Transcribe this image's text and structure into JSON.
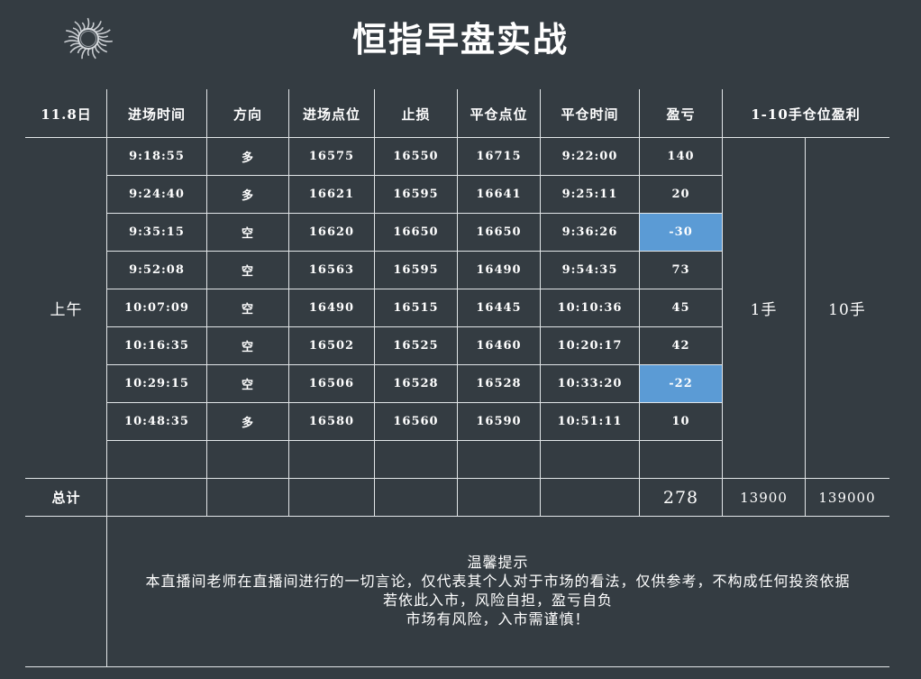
{
  "title": "恒指早盘实战",
  "logo_icon": "sun-icon",
  "colors": {
    "background": "#343c42",
    "loss_highlight": "#5b9bd5",
    "grid": "#e2e6e8"
  },
  "header": {
    "date": "11.8日",
    "entry_time": "进场时间",
    "direction": "方向",
    "entry_price": "进场点位",
    "stop_loss": "止损",
    "exit_price": "平仓点位",
    "exit_time": "平仓时间",
    "pnl": "盈亏",
    "profit_1_10": "1-10手仓位盈利"
  },
  "session_label": "上午",
  "rows": [
    {
      "entry_time": "9:18:55",
      "direction": "多",
      "entry": "16575",
      "stop": "16550",
      "exit": "16715",
      "exit_time": "9:22:00",
      "pnl": "140",
      "loss": false
    },
    {
      "entry_time": "9:24:40",
      "direction": "多",
      "entry": "16621",
      "stop": "16595",
      "exit": "16641",
      "exit_time": "9:25:11",
      "pnl": "20",
      "loss": false
    },
    {
      "entry_time": "9:35:15",
      "direction": "空",
      "entry": "16620",
      "stop": "16650",
      "exit": "16650",
      "exit_time": "9:36:26",
      "pnl": "-30",
      "loss": true
    },
    {
      "entry_time": "9:52:08",
      "direction": "空",
      "entry": "16563",
      "stop": "16595",
      "exit": "16490",
      "exit_time": "9:54:35",
      "pnl": "73",
      "loss": false
    },
    {
      "entry_time": "10:07:09",
      "direction": "空",
      "entry": "16490",
      "stop": "16515",
      "exit": "16445",
      "exit_time": "10:10:36",
      "pnl": "45",
      "loss": false
    },
    {
      "entry_time": "10:16:35",
      "direction": "空",
      "entry": "16502",
      "stop": "16525",
      "exit": "16460",
      "exit_time": "10:20:17",
      "pnl": "42",
      "loss": false
    },
    {
      "entry_time": "10:29:15",
      "direction": "空",
      "entry": "16506",
      "stop": "16528",
      "exit": "16528",
      "exit_time": "10:33:20",
      "pnl": "-22",
      "loss": true
    },
    {
      "entry_time": "10:48:35",
      "direction": "多",
      "entry": "16580",
      "stop": "16560",
      "exit": "16590",
      "exit_time": "10:51:11",
      "pnl": "10",
      "loss": false
    },
    {
      "entry_time": "",
      "direction": "",
      "entry": "",
      "stop": "",
      "exit": "",
      "exit_time": "",
      "pnl": "",
      "loss": false
    }
  ],
  "lot_1": "1手",
  "lot_10": "10手",
  "total": {
    "label": "总计",
    "pnl": "278",
    "profit_1": "13900",
    "profit_10": "139000"
  },
  "notice": {
    "title": "温馨提示",
    "line1": "本直播间老师在直播间进行的一切言论，仅代表其个人对于市场的看法，仅供参考，不构成任何投资依据",
    "line2": "若依此入市，风险自担，盈亏自负",
    "line3": "市场有风险，入市需谨慎！"
  }
}
